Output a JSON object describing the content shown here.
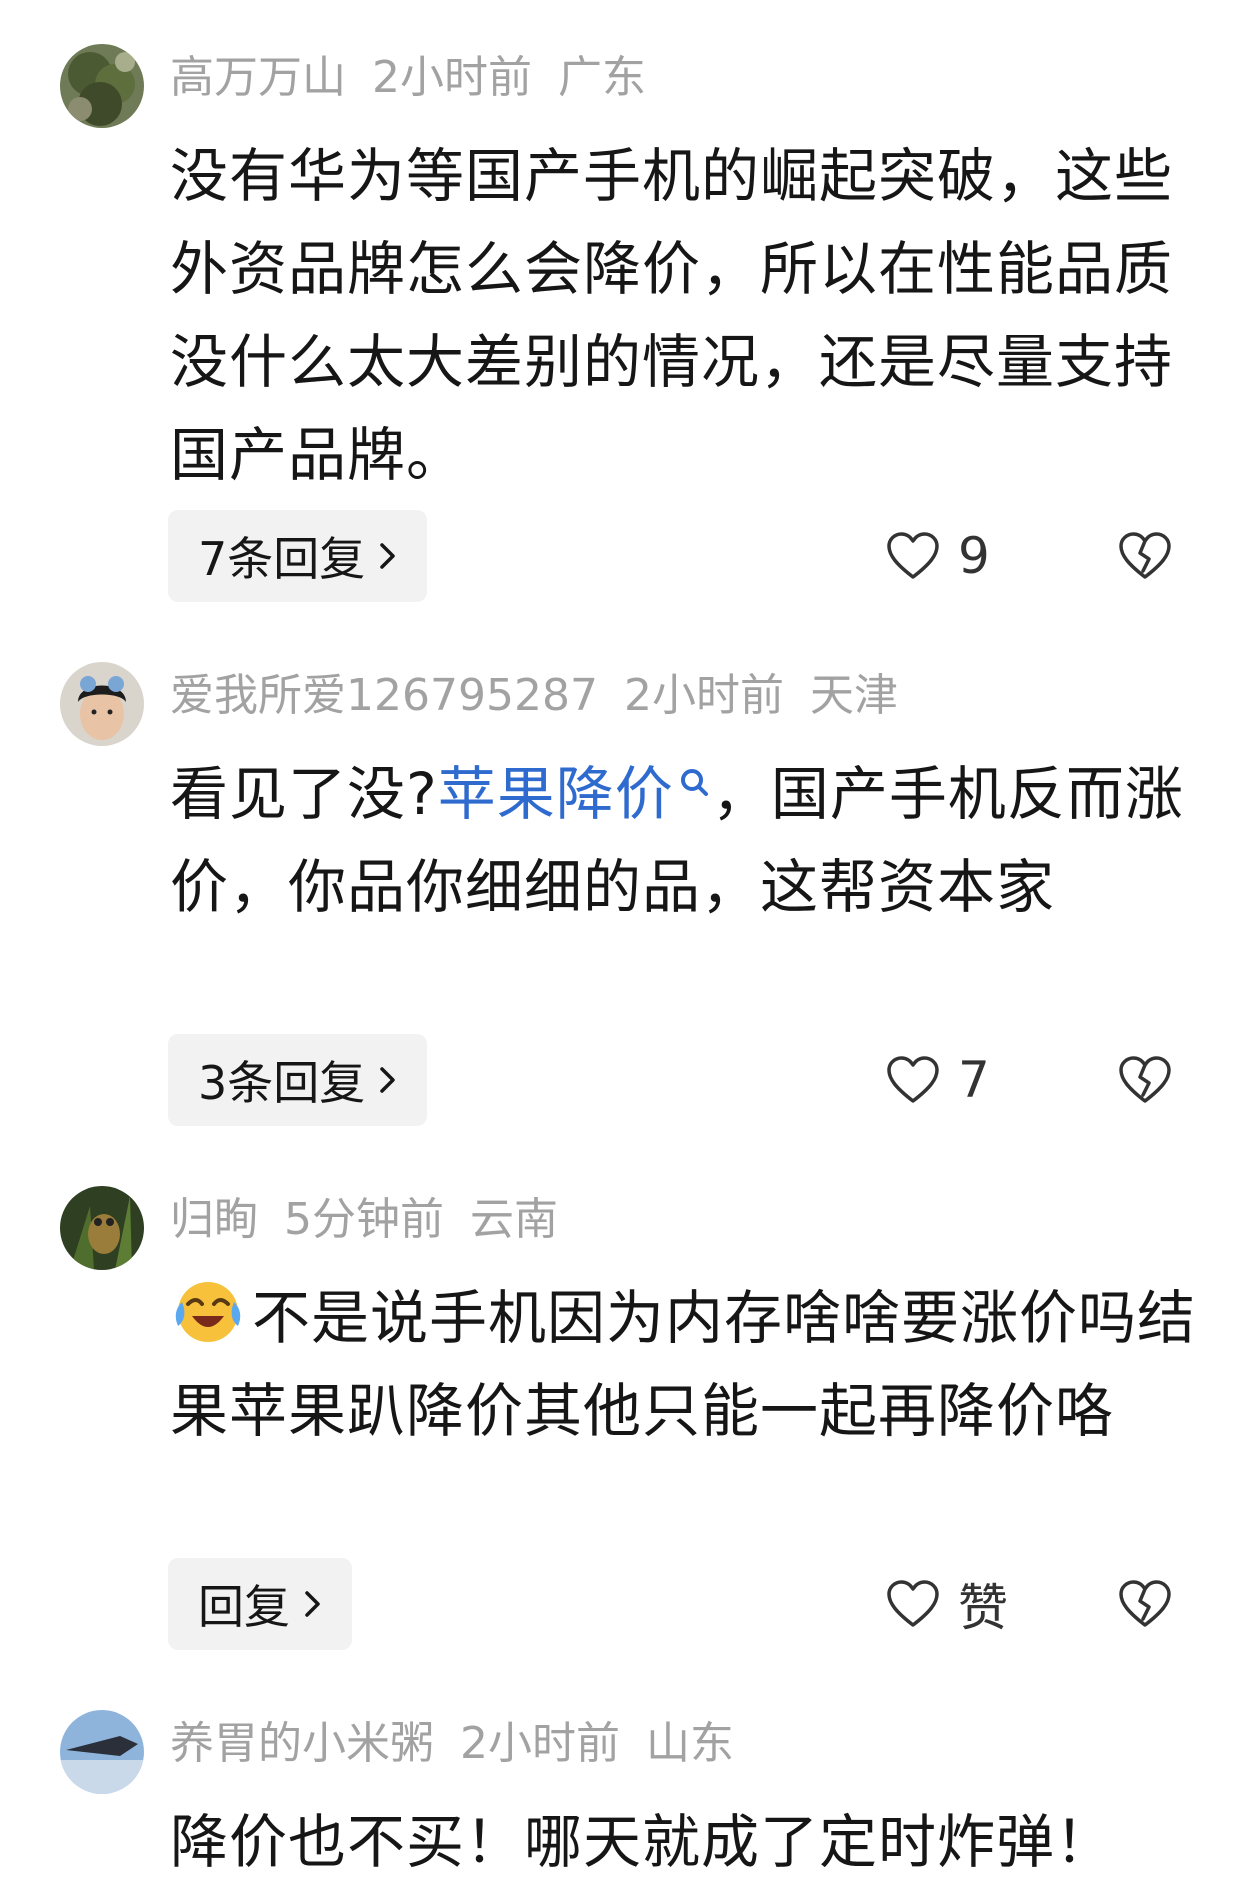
{
  "comments": [
    {
      "username": "高万万山",
      "time": "2小时前",
      "location": "广东",
      "text": "没有华为等国产手机的崛起突破，这些外资品牌怎么会降价，所以在性能品质没什么太大差别的情况，还是尽量支持国产品牌。",
      "reply_label": "7条回复",
      "like_count": "9",
      "avatar_icon": "mountain-tree-avatar"
    },
    {
      "username": "爱我所爱126795287",
      "time": "2小时前",
      "location": "天津",
      "text_before_link": "看见了没?",
      "link_text": "苹果降价",
      "text_after_link": "，国产手机反而涨价，你品你细细的品，这帮资本家",
      "reply_label": "3条回复",
      "like_count": "7",
      "avatar_icon": "person-avatar"
    },
    {
      "username": "归眴",
      "time": "5分钟前",
      "location": "云南",
      "emoji": "laughing-crying-emoji",
      "text": "不是说手机因为内存啥啥要涨价吗结果苹果趴降价其他只能一起再降价咯",
      "reply_label": "回复",
      "like_count": "赞",
      "avatar_icon": "frog-avatar"
    },
    {
      "username": "养胃的小米粥",
      "time": "2小时前",
      "location": "山东",
      "text": "降价也不买！哪天就成了定时炸弹！",
      "avatar_icon": "jet-avatar"
    }
  ],
  "colors": {
    "meta": "#a2a2a2",
    "link": "#2f6bcf",
    "text": "#161616",
    "reply_bg": "#f2f2f2"
  }
}
